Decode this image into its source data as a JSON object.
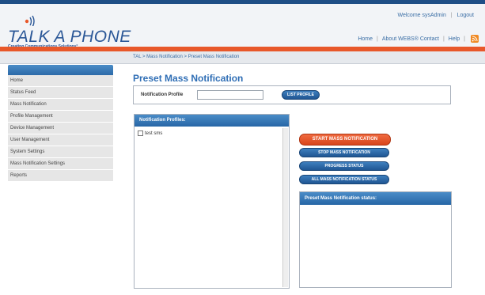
{
  "header": {
    "logo_title": "TALK A PHONE",
    "logo_tagline": "Creating Communications Solutions°",
    "welcome": "Welcome sysAdmin",
    "logout": "Logout",
    "nav": {
      "home": "Home",
      "about": "About WEBS® Contact",
      "help": "Help"
    }
  },
  "breadcrumb": "TAL > Mass Notification > Preset Mass Notification",
  "sidebar": {
    "items": [
      {
        "label": "Home"
      },
      {
        "label": "Status Feed"
      },
      {
        "label": "Mass Notification"
      },
      {
        "label": "Profile Management"
      },
      {
        "label": "Device Management"
      },
      {
        "label": "User Management"
      },
      {
        "label": "System Settings"
      },
      {
        "label": "Mass Notification Settings"
      },
      {
        "label": "Reports"
      }
    ]
  },
  "main": {
    "title": "Preset Mass Notification",
    "profile_label": "Notification Profile",
    "profile_value": "",
    "list_profile_button": "LIST PROFILE",
    "profiles_panel": {
      "title": "Notification Profiles:",
      "items": [
        {
          "label": "test sms",
          "checked": false
        }
      ]
    },
    "buttons": {
      "start": "START MASS NOTIFICATION",
      "stop": "STOP MASS NOTIFICATION",
      "progress": "PROGRESS STATUS",
      "all_status": "ALL MASS NOTIFICATION STATUS"
    },
    "status_panel": {
      "title": "Preset Mass Notification status:"
    }
  },
  "colors": {
    "accent_blue": "#2f6eb5",
    "accent_orange": "#e8582a",
    "nav_dark": "#1f4f86"
  }
}
